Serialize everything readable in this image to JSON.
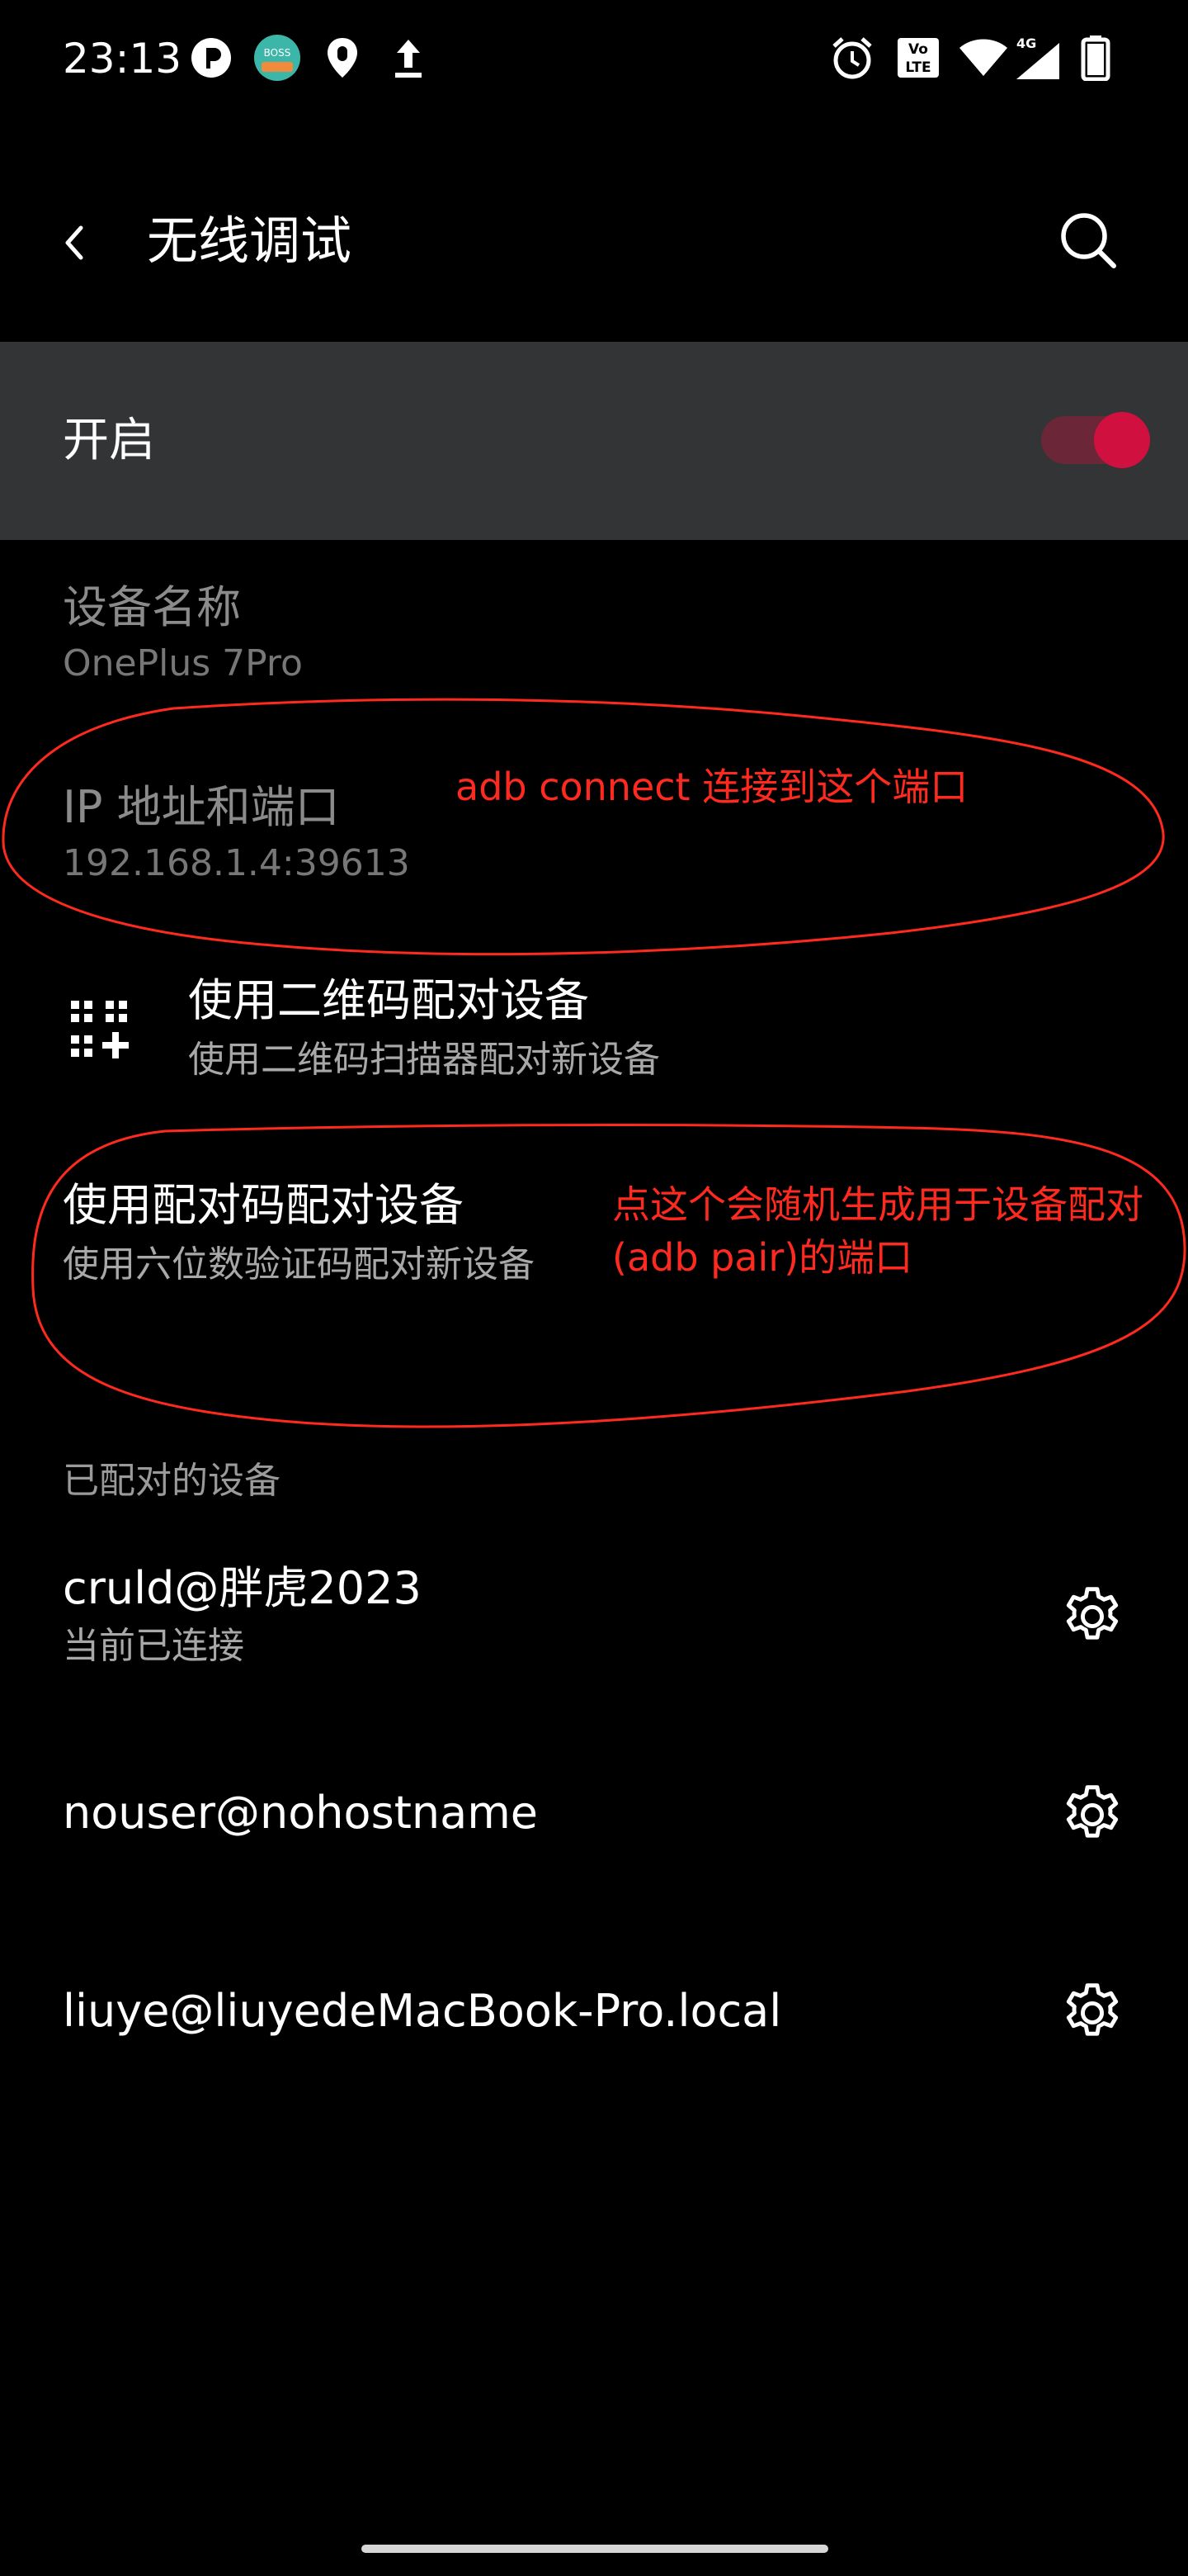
{
  "status_bar": {
    "time": "23:13",
    "left_icons": [
      "p-notification-icon",
      "boss-app-icon",
      "location-pin-icon",
      "upload-icon"
    ],
    "right_icons": [
      "alarm-icon",
      "volte-icon",
      "wifi-icon",
      "signal-4g-icon",
      "battery-icon"
    ],
    "volte_label": "Vo LTE",
    "network_label": "4G"
  },
  "app_bar": {
    "title": "无线调试",
    "back_icon": "back-arrow-icon",
    "search_icon": "search-icon"
  },
  "master_toggle": {
    "label": "开启",
    "enabled": true
  },
  "device_name": {
    "title": "设备名称",
    "value": "OnePlus 7Pro"
  },
  "ip_port": {
    "title": "IP 地址和端口",
    "value": "192.168.1.4:39613"
  },
  "qr_pair": {
    "title": "使用二维码配对设备",
    "subtitle": "使用二维码扫描器配对新设备",
    "icon": "qr-code-icon"
  },
  "code_pair": {
    "title": "使用配对码配对设备",
    "subtitle": "使用六位数验证码配对新设备"
  },
  "annotations": {
    "ip_note": "adb connect 连接到这个端口",
    "pair_note_line1": "点这个会随机生成用于设备配对",
    "pair_note_line2": "(adb pair)的端口",
    "color": "#ff2a1f"
  },
  "paired_section": {
    "header": "已配对的设备",
    "devices": [
      {
        "name": "cruld@胖虎2023",
        "status": "当前已连接"
      },
      {
        "name": "nouser@nohostname",
        "status": ""
      },
      {
        "name": "liuye@liuyedeMacBook-Pro.local",
        "status": ""
      }
    ]
  },
  "colors": {
    "background": "#000000",
    "toggle_row_bg": "#333436",
    "accent": "#d0103e",
    "annotation": "#ff2a1f"
  }
}
